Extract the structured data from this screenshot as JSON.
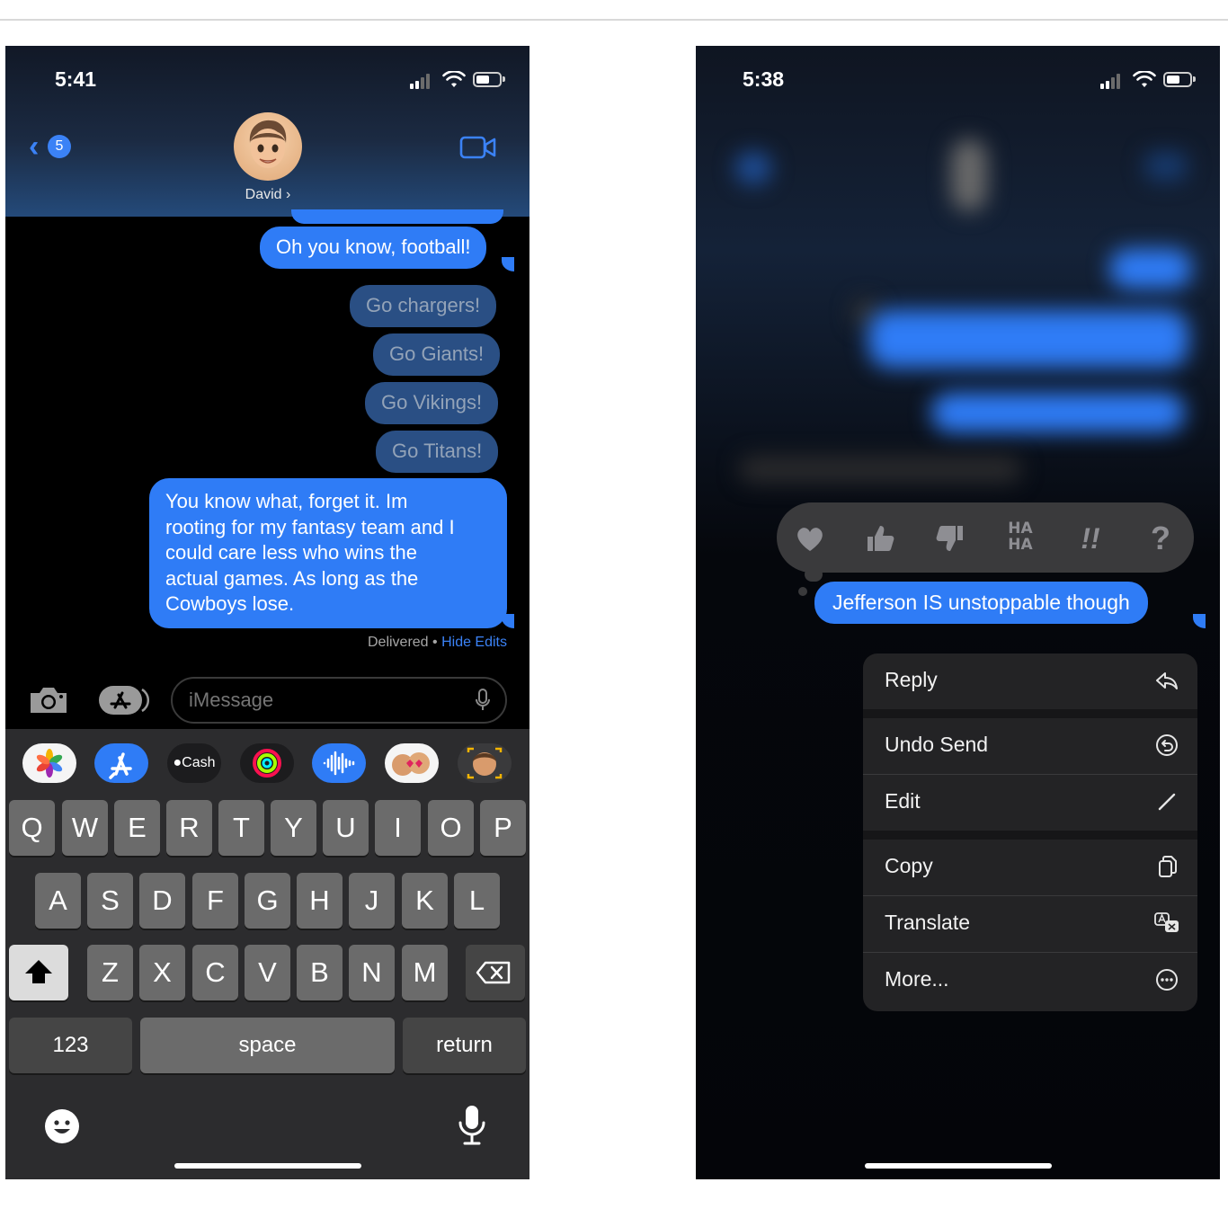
{
  "left": {
    "status": {
      "time": "5:41"
    },
    "header": {
      "back_badge": "5",
      "contact_name": "David ›"
    },
    "messages": [
      {
        "text": "Oh you know, football!",
        "style": "sent"
      },
      {
        "text": "Go chargers!",
        "style": "edited"
      },
      {
        "text": "Go Giants!",
        "style": "edited"
      },
      {
        "text": "Go Vikings!",
        "style": "edited"
      },
      {
        "text": "Go Titans!",
        "style": "edited"
      },
      {
        "lines": [
          "You know what, forget it. Im",
          "rooting for my fantasy team and I",
          "could care less who wins the",
          "actual games. As long as the",
          "Cowboys lose."
        ],
        "style": "sent"
      }
    ],
    "meta": {
      "delivered": "Delivered",
      "separator": " • ",
      "hide_edits": "Hide Edits"
    },
    "composer": {
      "placeholder": "iMessage"
    },
    "app_strip": {
      "cash_label": "Cash"
    },
    "keyboard": {
      "row1": [
        "Q",
        "W",
        "E",
        "R",
        "T",
        "Y",
        "U",
        "I",
        "O",
        "P"
      ],
      "row2": [
        "A",
        "S",
        "D",
        "F",
        "G",
        "H",
        "J",
        "K",
        "L"
      ],
      "row3": [
        "Z",
        "X",
        "C",
        "V",
        "B",
        "N",
        "M"
      ],
      "numbers": "123",
      "space": "space",
      "return": "return"
    }
  },
  "right": {
    "status": {
      "time": "5:38"
    },
    "message": "Jefferson IS unstoppable though",
    "reactions": [
      "heart",
      "thumbs-up",
      "thumbs-down",
      "ha-ha",
      "exclamation",
      "question"
    ],
    "reaction_text": {
      "haha": "HA HA",
      "exclaim": "!!",
      "question": "?"
    },
    "menu": [
      {
        "label": "Reply",
        "icon": "reply-icon"
      },
      {
        "label": "Undo Send",
        "icon": "undo-icon"
      },
      {
        "label": "Edit",
        "icon": "pencil-icon"
      },
      {
        "label": "Copy",
        "icon": "copy-icon"
      },
      {
        "label": "Translate",
        "icon": "translate-icon"
      },
      {
        "label": "More...",
        "icon": "more-icon"
      }
    ]
  },
  "colors": {
    "imessage_blue": "#2f7cf6",
    "link_blue": "#3b82f6",
    "keyboard_bg": "#2c2c2e",
    "menu_bg": "#232325"
  }
}
